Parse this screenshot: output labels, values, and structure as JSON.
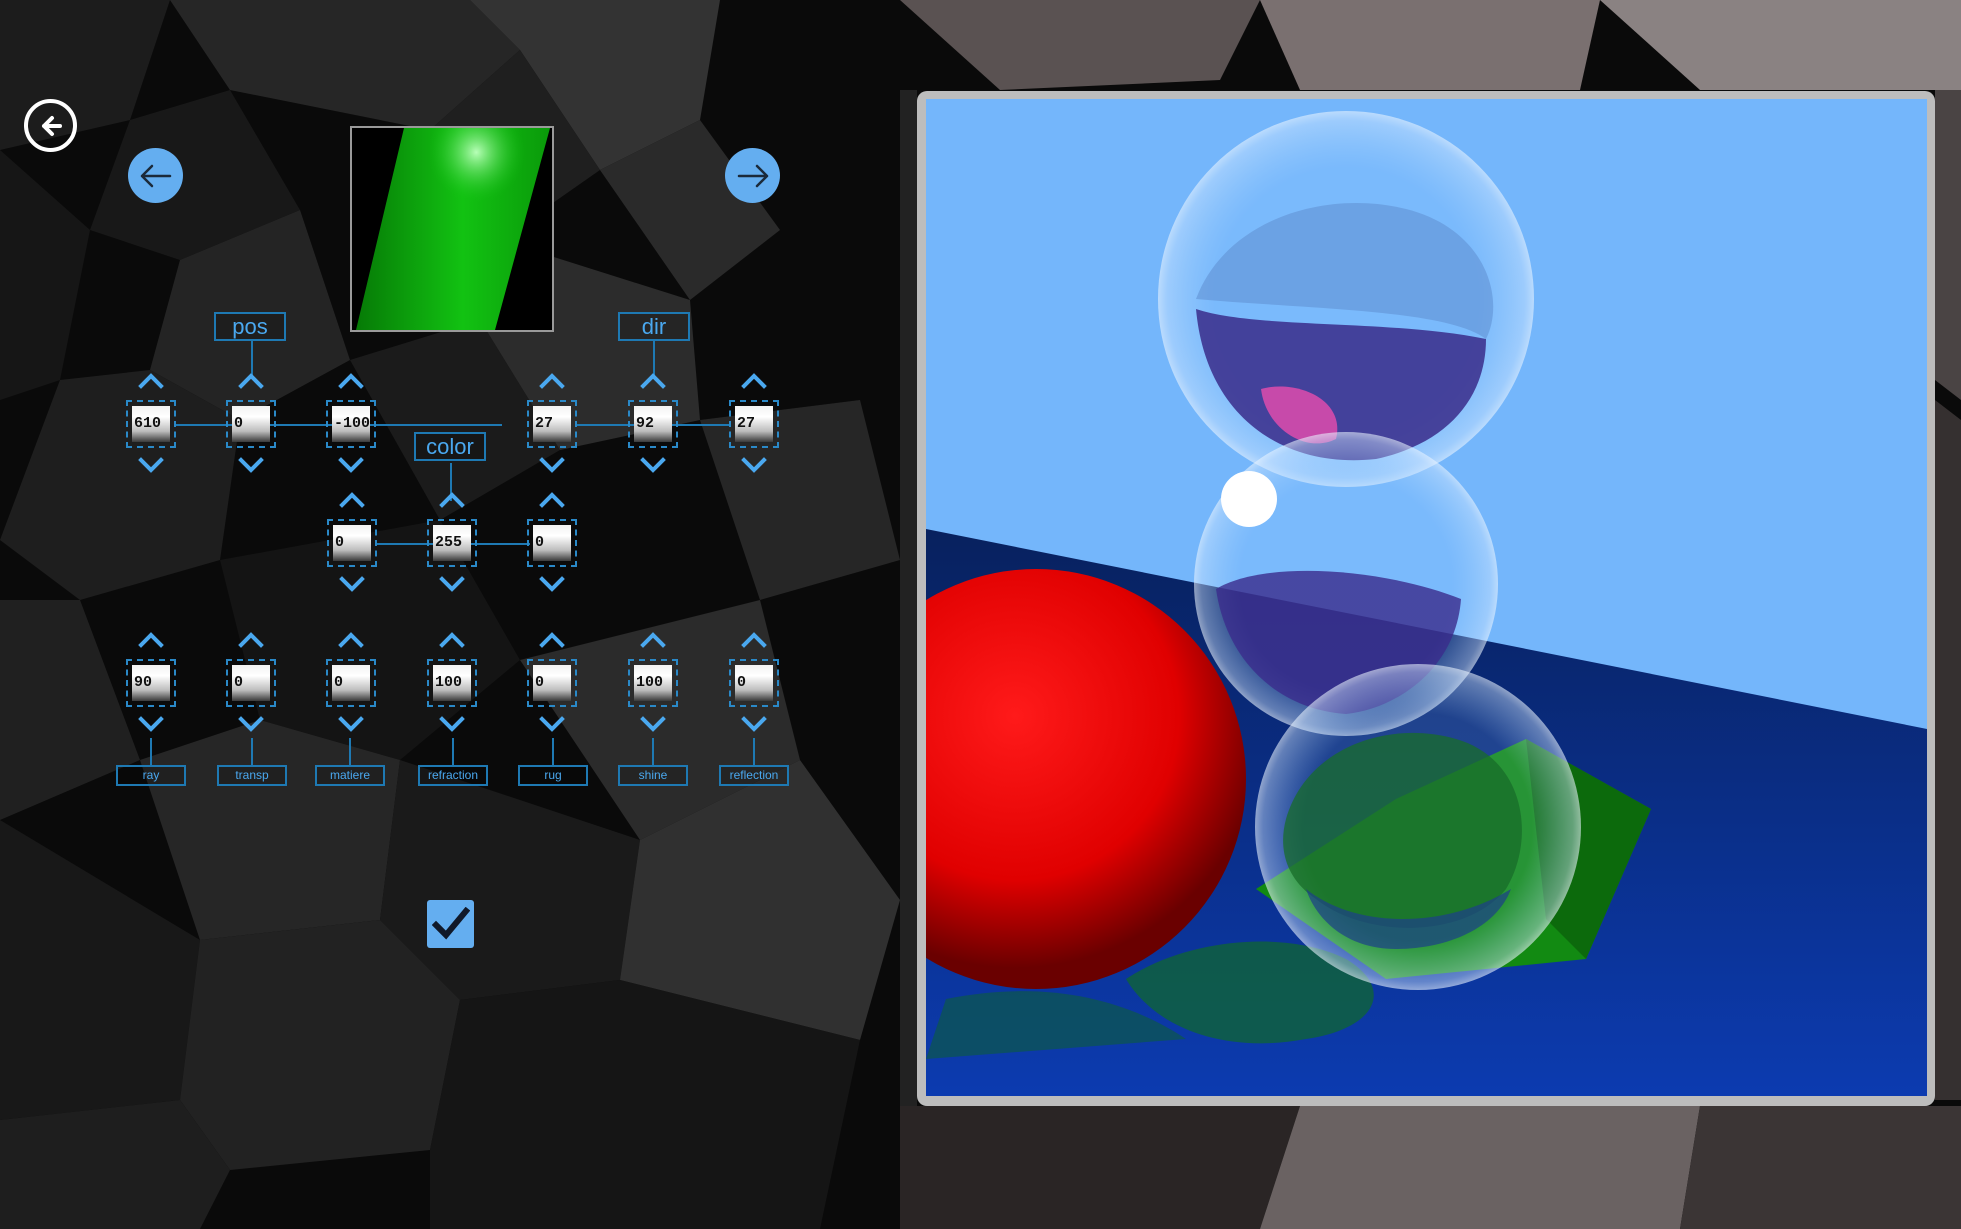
{
  "navigation": {
    "back_icon": "circle-arrow-left-icon",
    "prev_icon": "arrow-left-icon",
    "next_icon": "arrow-right-icon",
    "confirm_icon": "checkmark-icon"
  },
  "colors": {
    "accent": "#64aef0",
    "label_border": "#1e79b3",
    "label_text": "#4aa8ef",
    "preview_green": "#0aa10a",
    "sky": "#74b6fb",
    "floor": "#0b2a75",
    "red_sphere": "#ff0000"
  },
  "preview": {
    "description_icon": "material-preview"
  },
  "groups": {
    "pos": {
      "label": "pos",
      "values": [
        "610",
        "0",
        "-100"
      ]
    },
    "dir": {
      "label": "dir",
      "values": [
        "27",
        "92",
        "27"
      ]
    },
    "color": {
      "label": "color",
      "values": [
        "0",
        "255",
        "0"
      ]
    }
  },
  "properties": [
    {
      "label": "ray",
      "value": "90"
    },
    {
      "label": "transp",
      "value": "0"
    },
    {
      "label": "matiere",
      "value": "0"
    },
    {
      "label": "refraction",
      "value": "100"
    },
    {
      "label": "rug",
      "value": "0"
    },
    {
      "label": "shine",
      "value": "100"
    },
    {
      "label": "reflection",
      "value": "0"
    }
  ]
}
